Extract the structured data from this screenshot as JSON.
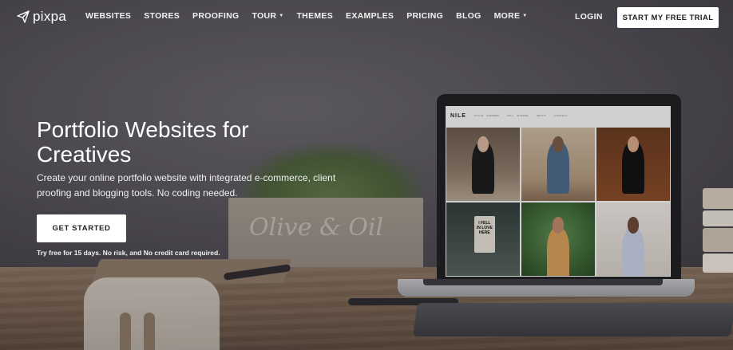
{
  "brand": {
    "name": "pixpa",
    "icon": "paper-plane-icon"
  },
  "nav": {
    "links": [
      {
        "label": "WEBSITES",
        "dropdown": false
      },
      {
        "label": "STORES",
        "dropdown": false
      },
      {
        "label": "PROOFING",
        "dropdown": false
      },
      {
        "label": "TOUR",
        "dropdown": true
      },
      {
        "label": "THEMES",
        "dropdown": false
      },
      {
        "label": "EXAMPLES",
        "dropdown": false
      },
      {
        "label": "PRICING",
        "dropdown": false
      },
      {
        "label": "BLOG",
        "dropdown": false
      },
      {
        "label": "MORE",
        "dropdown": true
      }
    ],
    "login": "LOGIN",
    "trial_button": "START MY FREE TRIAL",
    "caret_glyph": "▼"
  },
  "hero": {
    "title": "Portfolio Websites for Creatives",
    "subtitle": "Create your online portfolio website with integrated e-commerce, client proofing and blogging tools. No coding needed.",
    "cta": "GET STARTED",
    "note": "Try free for 15 days. No risk, and No credit card required."
  },
  "scene": {
    "planter_text": "Olive & Oil",
    "laptop": {
      "site_name": "NILE",
      "menu": [
        "STYLE · SUMMER",
        "FALL · WINTER",
        "ABOUT",
        "CONTACT"
      ],
      "sign_text": "I FELL IN LOVE HERE"
    }
  },
  "colors": {
    "button_bg": "#ffffff",
    "button_text": "#222222",
    "nav_text": "#f2f2f2"
  }
}
